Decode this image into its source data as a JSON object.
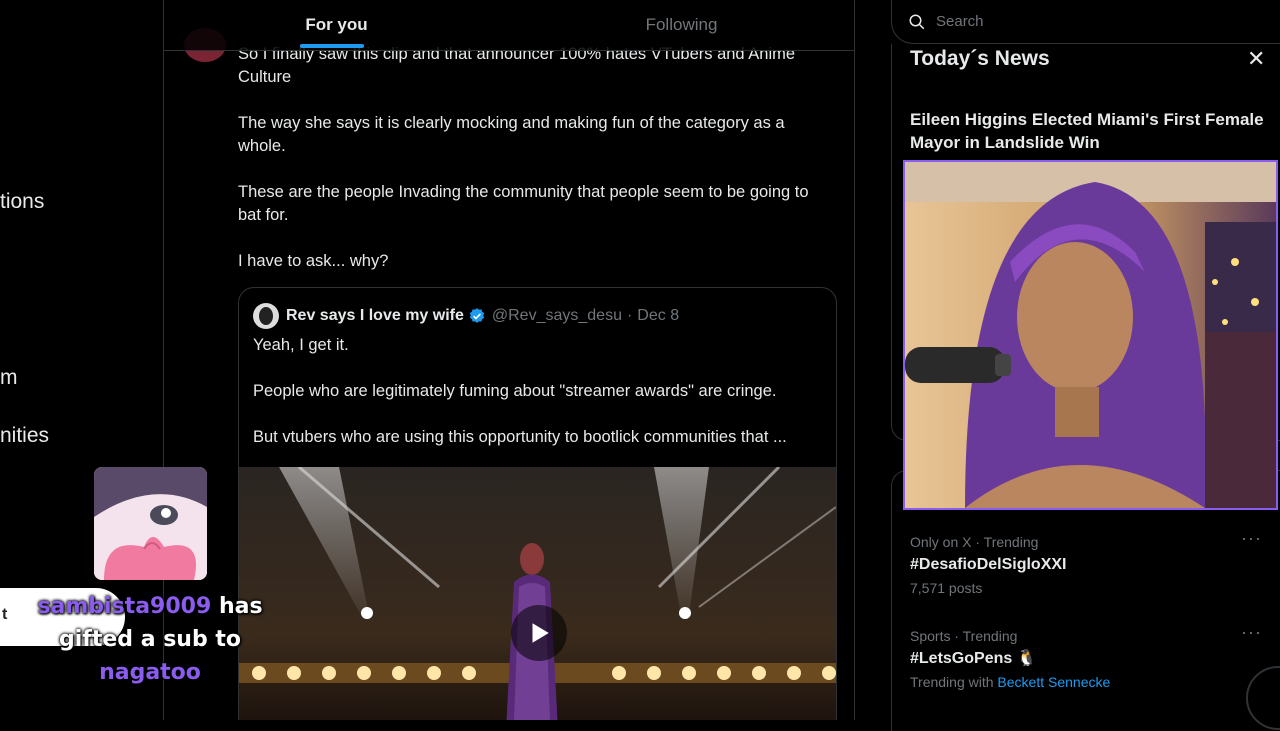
{
  "nav": {
    "items": [
      {
        "label": "tions"
      },
      {
        "label": "m"
      },
      {
        "label": "nities"
      }
    ]
  },
  "tabs": {
    "for_you": "For you",
    "following": "Following"
  },
  "tweet": {
    "paragraphs": [
      "So I finally saw this clip and that announcer 100% hates VTubers and Anime Culture",
      "The way she says it is clearly mocking and making fun of the category as a whole.",
      "These are the people Invading the community that people seem to be going to bat for.",
      "I have to ask... why?"
    ]
  },
  "quote": {
    "name": "Rev says I love my wife",
    "handle": "@Rev_says_desu",
    "date": "Dec 8",
    "separator": "·",
    "paragraphs": [
      "Yeah, I get it.",
      "People who are legitimately fuming about \"streamer awards\" are cringe.",
      "But vtubers who are using this opportunity to bootlick communities that ..."
    ]
  },
  "search": {
    "placeholder": "Search"
  },
  "news": {
    "title": "Today´s News",
    "close": "✕",
    "headline": "Eileen Higgins Elected Miami's First Female Mayor in Landslide Win"
  },
  "trends": [
    {
      "meta": "Only on X · Trending",
      "name": "#DesafioDelSigloXXI",
      "sub": "7,571 posts",
      "link": ""
    },
    {
      "meta": "Sports · Trending",
      "name": "#LetsGoPens 🐧",
      "sub": "Trending with",
      "link": "Beckett Sennecke"
    }
  ],
  "alert": {
    "bubble": "t",
    "user": "sambista9009",
    "mid1": " has",
    "mid2": "gifted a sub to",
    "recipient": "nagatoo"
  },
  "colors": {
    "accent": "#1d9bf0",
    "overlay_purple": "#8a5cf0"
  }
}
